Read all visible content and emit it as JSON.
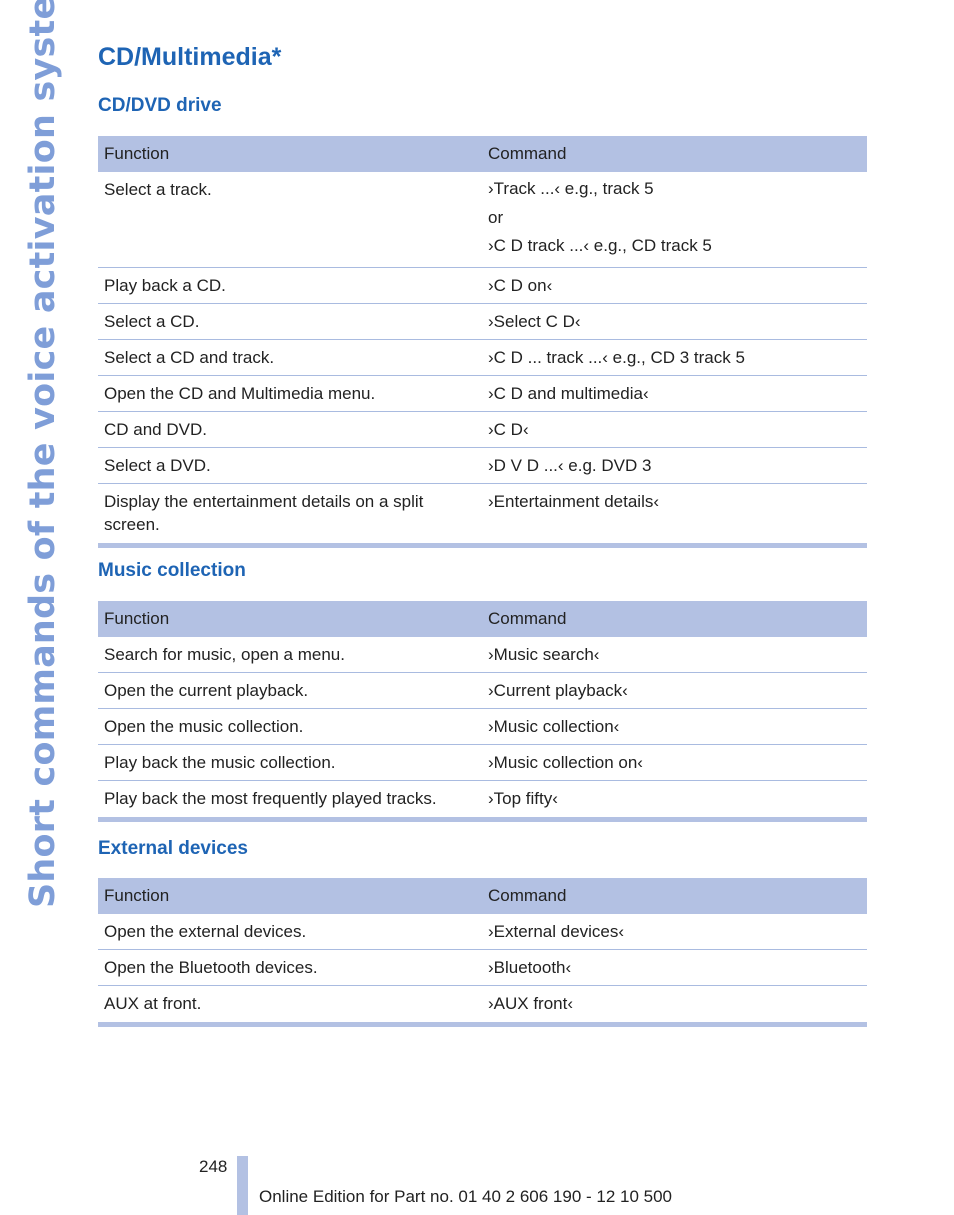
{
  "side_title": "Short commands of the voice activation system",
  "page_title": "CD/Multimedia*",
  "sections": [
    {
      "title": "CD/DVD drive",
      "columns": [
        "Function",
        "Command"
      ],
      "rows": [
        {
          "function": "Select a track.",
          "command": [
            "›Track ...‹ e.g., track 5",
            "or",
            "›C D track ...‹ e.g., CD track 5"
          ]
        },
        {
          "function": "Play back a CD.",
          "command": [
            "›C D on‹"
          ]
        },
        {
          "function": "Select a CD.",
          "command": [
            "›Select C D‹"
          ]
        },
        {
          "function": "Select a CD and track.",
          "command": [
            "›C D ... track ...‹ e.g., CD 3 track 5"
          ]
        },
        {
          "function": "Open the CD and Multimedia menu.",
          "command": [
            "›C D and multimedia‹"
          ]
        },
        {
          "function": "CD and DVD.",
          "command": [
            "›C D‹"
          ]
        },
        {
          "function": "Select a DVD.",
          "command": [
            "›D V D ...‹ e.g. DVD 3"
          ]
        },
        {
          "function": "Display the entertainment details on a split screen.",
          "command": [
            "›Entertainment details‹"
          ]
        }
      ]
    },
    {
      "title": "Music collection",
      "columns": [
        "Function",
        "Command"
      ],
      "rows": [
        {
          "function": "Search for music, open a menu.",
          "command": [
            "›Music search‹"
          ]
        },
        {
          "function": "Open the current playback.",
          "command": [
            "›Current playback‹"
          ]
        },
        {
          "function": "Open the music collection.",
          "command": [
            "›Music collection‹"
          ]
        },
        {
          "function": "Play back the music collection.",
          "command": [
            "›Music collection on‹"
          ]
        },
        {
          "function": "Play back the most frequently played tracks.",
          "command": [
            "›Top fifty‹"
          ]
        }
      ]
    },
    {
      "title": "External devices",
      "columns": [
        "Function",
        "Command"
      ],
      "rows": [
        {
          "function": "Open the external devices.",
          "command": [
            "›External devices‹"
          ]
        },
        {
          "function": "Open the Bluetooth devices.",
          "command": [
            "›Bluetooth‹"
          ]
        },
        {
          "function": "AUX at front.",
          "command": [
            "›AUX front‹"
          ]
        }
      ]
    }
  ],
  "footer": {
    "page_number": "248",
    "edition_text": "Online Edition for Part no. 01 40 2 606 190 - 12 10 500"
  },
  "colors": {
    "heading_blue": "#1e64b4",
    "table_header_fill": "#b3c1e3",
    "row_rule": "#a9bbe0",
    "side_title": "#7f9ed8"
  }
}
